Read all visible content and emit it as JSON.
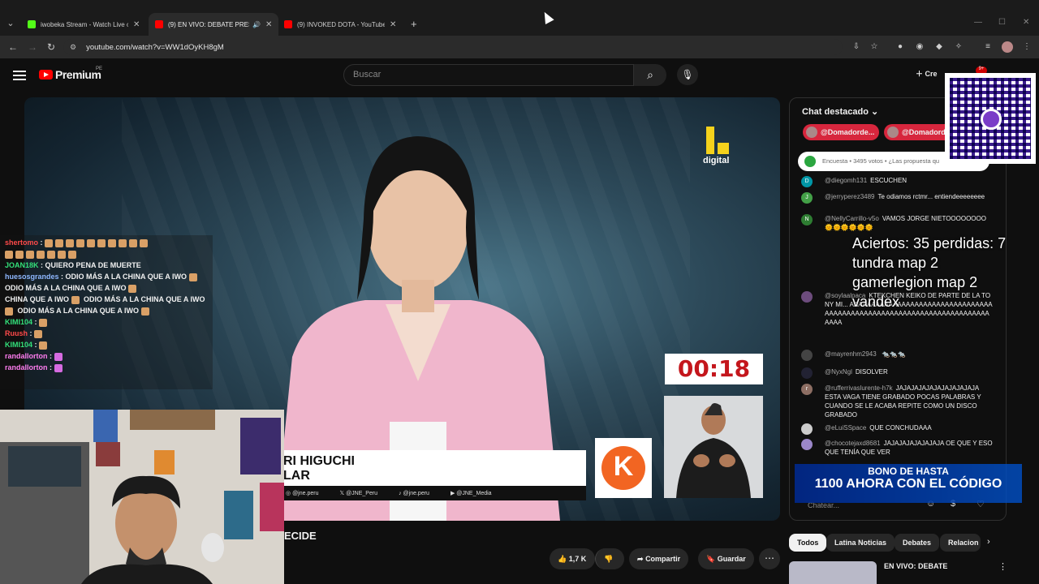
{
  "browser": {
    "tabs": [
      {
        "title": "iwobeka Stream - Watch Live o",
        "favicon_color": "#53fc18"
      },
      {
        "title": "(9) EN VIVO: DEBATE PRESI",
        "favicon_color": "#ff0000"
      },
      {
        "title": "(9) INVOKED DOTA - YouTube",
        "favicon_color": "#ff0000"
      }
    ],
    "url": "youtube.com/watch?v=WW1dOyKH8gM"
  },
  "youtube": {
    "logo_text": "Premium",
    "country_code": "PE",
    "search_placeholder": "Buscar",
    "create_label": "Cre",
    "notif_count": "9+"
  },
  "video": {
    "channel_logo_label": "digital",
    "timer": "00:18",
    "lower_third_line1": "RI HIGUCHI",
    "lower_third_line2": "LAR",
    "socials": [
      "@jne.peru",
      "@JNE_Peru",
      "@jne.peru",
      "@JNE_Media"
    ],
    "k_logo": "K",
    "title_fragment": "ECIDE",
    "likes": "1,7 K",
    "share_label": "Compartir",
    "save_label": "Guardar"
  },
  "overlay_chat": [
    {
      "user": "shertomo",
      "text": "",
      "color": "#ff4a4a"
    },
    {
      "user": "JOAN18K",
      "text": "QUIERO PENA DE MUERTE",
      "color": "#33e07a"
    },
    {
      "user": "huesosgrandes",
      "text": "ODIO MÁS A LA CHINA QUE A IWO",
      "color": "#8fb8ff"
    },
    {
      "user": "",
      "text": "ODIO MÁS A LA CHINA QUE A IWO",
      "color": "#ffffff"
    },
    {
      "user": "",
      "text": "CHINA QUE A IWO",
      "color": "#ffffff"
    },
    {
      "user": "",
      "text": "ODIO MÁS A LA CHINA QUE A IWO",
      "color": "#ffffff"
    },
    {
      "user": "KIMI104",
      "text": "",
      "color": "#33e07a"
    },
    {
      "user": "Ruush",
      "text": "",
      "color": "#ff4a4a"
    },
    {
      "user": "KIMI104",
      "text": "",
      "color": "#33e07a"
    },
    {
      "user": "randallorton",
      "text": "",
      "color": "#ff7df0"
    },
    {
      "user": "randallorton",
      "text": "",
      "color": "#ff7df0"
    }
  ],
  "chat": {
    "header": "Chat destacado",
    "donors": [
      "@Domadorde...",
      "@Domadorde"
    ],
    "poll": "Encuesta • 3495 votos • ¿Las propuesta qu",
    "messages": [
      {
        "author": "@diegomh131",
        "text": "ESCUCHEN",
        "avatar": "D",
        "color": "#0097a7"
      },
      {
        "author": "@jerryperez3489",
        "text": "Te odiamos rctmr... entiendeeeeeeee",
        "avatar": "J",
        "color": "#43a047"
      },
      {
        "author": "@NellyCarrillo-v5o",
        "text": "VAMOS JORGE NIETOOOOOOOO",
        "avatar": "N",
        "color": "#2e7d32"
      },
      {
        "author": "@soylaalpaca",
        "text": "KTEKCHEN KEIKO DE PARTE DE LA TONY MI... AAAAAAAAAAAAAAAAAAAAAAAAAAAAAAAAAAAAAAAAAAAAAAAAAAAAAAAAAAAAAAAAAAAAAAAAAAA",
        "avatar": "",
        "color": "#6d4c7d"
      },
      {
        "author": "@mayrenhm2943",
        "text": "",
        "avatar": "",
        "color": "#444"
      },
      {
        "author": "@NyxNgl",
        "text": "DISOLVER",
        "avatar": "",
        "color": "#223"
      },
      {
        "author": "@rufferrivaslurente-h7k",
        "text": "JAJAJAJAJAJAJAJAJAJAJA ESTA VAGA TIENE GRABADO POCAS PALABRAS Y CUANDO SE LE ACABA REPITE COMO UN DISCO GRABADO",
        "avatar": "r",
        "color": "#8d6e63"
      },
      {
        "author": "@eLuiSSpace",
        "text": "QUE CONCHUDAAA",
        "avatar": "",
        "color": "#ccc"
      },
      {
        "author": "@chocotejaxd8681",
        "text": "JAJAJAJAJAJAJAJA OE QUE Y ESO QUE TENÍA QUE VER",
        "avatar": "",
        "color": "#9b87c9"
      }
    ],
    "input_placeholder": "Chatear..."
  },
  "overlay_stats": {
    "line1": "Aciertos: 35 perdidas: 7",
    "line2": "tundra map 2",
    "line3": "gamerlegion map 2",
    "line4": "vandex"
  },
  "bonus": {
    "line1": "BONO DE HASTA",
    "line2": "1100 AHORA CON EL CÓDIGO"
  },
  "chips": [
    "Todos",
    "Latina Noticias",
    "Debates",
    "Relacion"
  ],
  "related": {
    "title": "EN VIVO: DEBATE"
  }
}
